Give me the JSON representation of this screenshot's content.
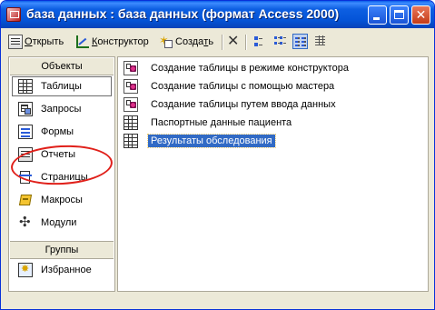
{
  "window": {
    "title": "база данных : база данных (формат Access 2000)",
    "title_icon": "access-db-icon",
    "controls": [
      "minimize",
      "maximize",
      "close"
    ]
  },
  "toolbar": {
    "open_label_pre": "",
    "open_label_u": "О",
    "open_label_post": "ткрыть",
    "design_label_u": "К",
    "design_label_post": "онструктор",
    "create_label_pre": "Созда",
    "create_label_u": "т",
    "create_label_post": "ь",
    "views": [
      "large-icons",
      "small-icons",
      "list",
      "details"
    ],
    "active_view": "list"
  },
  "sidebar": {
    "objects_header": "Объекты",
    "items": [
      {
        "label": "Таблицы",
        "icon": "table-icon",
        "selected": true
      },
      {
        "label": "Запросы",
        "icon": "query-icon",
        "selected": false
      },
      {
        "label": "Формы",
        "icon": "form-icon",
        "selected": false
      },
      {
        "label": "Отчеты",
        "icon": "report-icon",
        "selected": false
      },
      {
        "label": "Страницы",
        "icon": "page-icon",
        "selected": false
      },
      {
        "label": "Макросы",
        "icon": "macro-icon",
        "selected": false
      },
      {
        "label": "Модули",
        "icon": "module-icon",
        "selected": false
      }
    ],
    "groups_header": "Группы",
    "groups": [
      {
        "label": "Избранное",
        "icon": "favorites-icon"
      }
    ]
  },
  "list": {
    "items": [
      {
        "label": "Создание таблицы в режиме конструктора",
        "icon": "wizard-icon"
      },
      {
        "label": "Создание таблицы с помощью мастера",
        "icon": "wizard-icon"
      },
      {
        "label": "Создание таблицы путем ввода данных",
        "icon": "wizard-icon"
      },
      {
        "label": "Паспортные данные пациента",
        "icon": "table-icon"
      },
      {
        "label": "Результаты обследования",
        "icon": "table-icon",
        "selected": true
      }
    ]
  },
  "annotation": {
    "color": "#e0201a",
    "target": "Запросы"
  },
  "colors": {
    "titlebar": "#0454d8",
    "selection": "#316ac5",
    "face": "#ece9d8"
  }
}
